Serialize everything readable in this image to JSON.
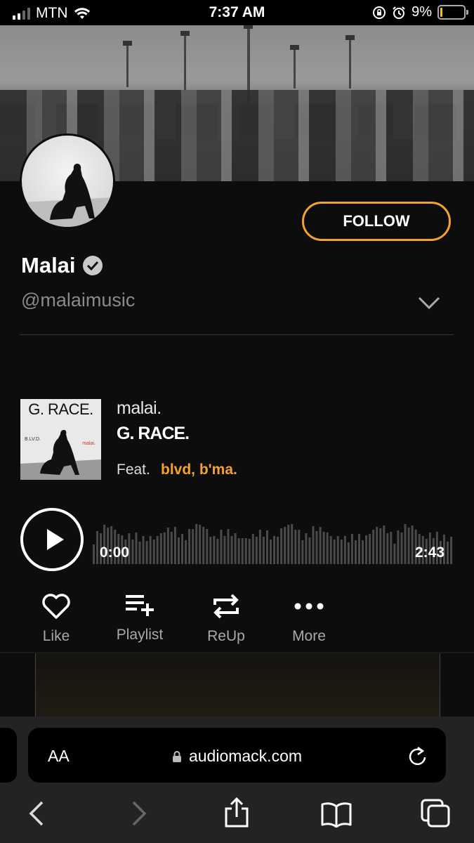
{
  "status": {
    "carrier": "MTN",
    "time": "7:37 AM",
    "battery": "9%",
    "battery_level": 0.09
  },
  "profile": {
    "name": "Malai",
    "handle": "@malaimusic",
    "follow_label": "FOLLOW",
    "accent_color": "#f2a233"
  },
  "track": {
    "cover_title": "G. RACE.",
    "cover_left": "B.LV.D.",
    "cover_right": "malai.",
    "artist": "malai.",
    "title": "G. RACE.",
    "feat_label": "Feat.",
    "featuring": "blvd, b'ma.",
    "time_current": "0:00",
    "time_total": "2:43"
  },
  "actions": [
    {
      "label": "Like",
      "icon": "heart-icon"
    },
    {
      "label": "Playlist",
      "icon": "playlist-add-icon"
    },
    {
      "label": "ReUp",
      "icon": "repeat-icon"
    },
    {
      "label": "More",
      "icon": "more-dots-icon"
    }
  ],
  "browser": {
    "text_size_label": "AA",
    "url": "audiomack.com"
  }
}
